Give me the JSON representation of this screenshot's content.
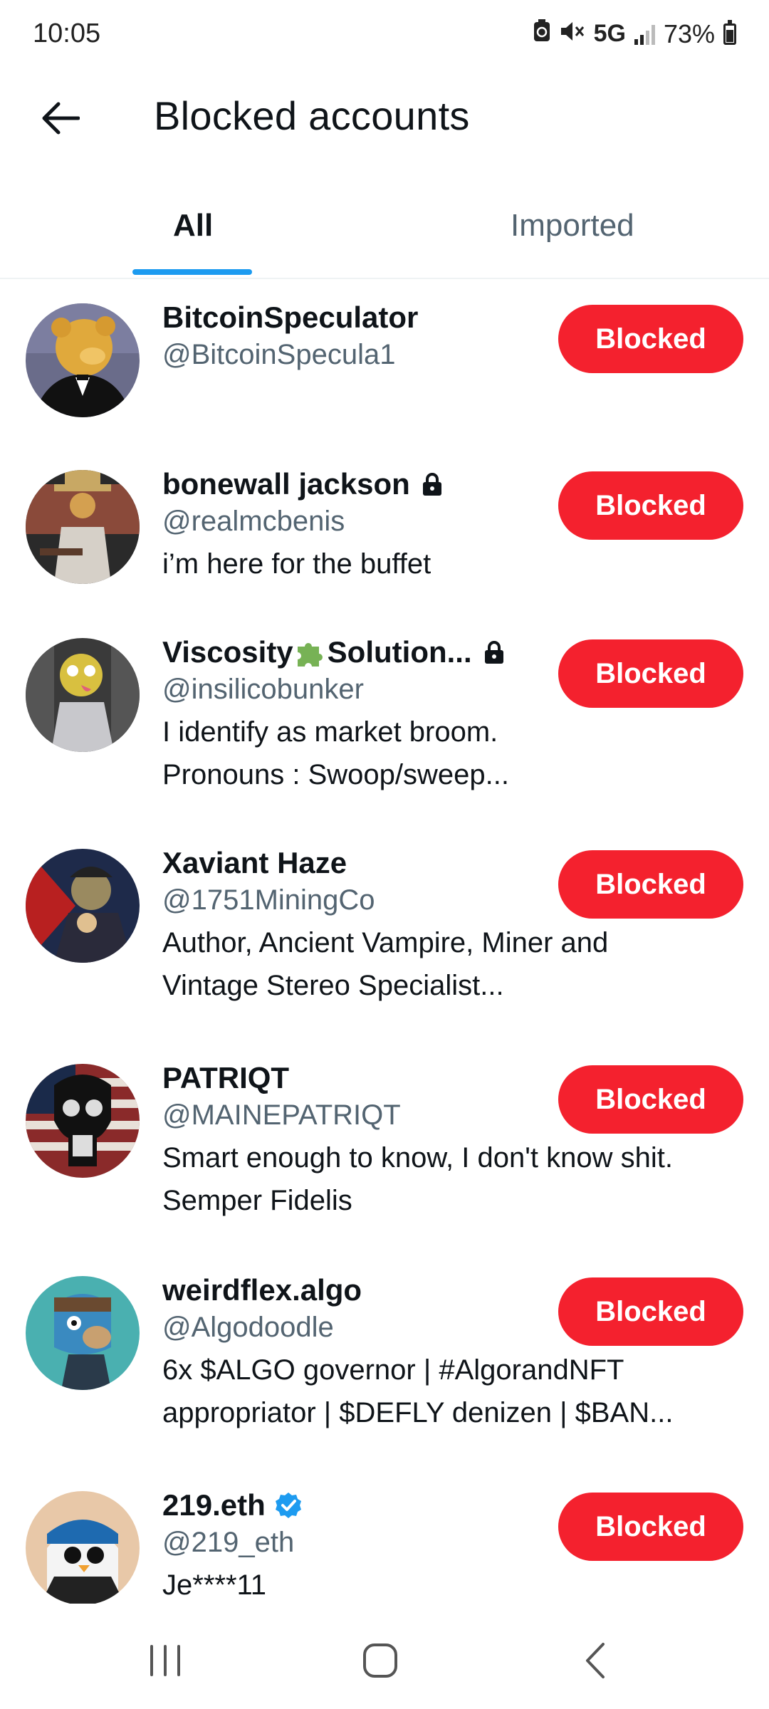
{
  "status_bar": {
    "time": "10:05",
    "network": "5G",
    "battery": "73%"
  },
  "header": {
    "title": "Blocked accounts"
  },
  "tabs": [
    {
      "label": "All"
    },
    {
      "label": "Imported"
    }
  ],
  "accounts": [
    {
      "name": "BitcoinSpeculator",
      "handle": "@BitcoinSpecula1",
      "bio": [],
      "locked": false,
      "verified": false,
      "button": "Blocked"
    },
    {
      "name": "bonewall jackson",
      "handle": "@realmcbenis",
      "bio": [
        "i’m here for the buffet"
      ],
      "locked": true,
      "verified": false,
      "button": "Blocked"
    },
    {
      "name_parts": [
        "Viscosity",
        "Solution..."
      ],
      "handle": "@insilicobunker",
      "bio": [
        "I identify as market broom.",
        "Pronouns : Swoop/sweep..."
      ],
      "locked": true,
      "verified": false,
      "button": "Blocked"
    },
    {
      "name": "Xaviant Haze",
      "handle": "@1751MiningCo",
      "bio": [
        "Author, Ancient Vampire, Miner and",
        "Vintage Stereo Specialist..."
      ],
      "locked": false,
      "verified": false,
      "button": "Blocked"
    },
    {
      "name": "PATRIQT",
      "handle": "@MAINEPATRIQT",
      "bio": [
        "Smart enough to know, I don't know shit.",
        "Semper Fidelis"
      ],
      "locked": false,
      "verified": false,
      "button": "Blocked"
    },
    {
      "name": "weirdflex.algo",
      "handle": "@Algodoodle",
      "bio": [
        "6x $ALGO governor | #AlgorandNFT",
        "appropriator | $DEFLY denizen | $BAN..."
      ],
      "locked": false,
      "verified": false,
      "button": "Blocked"
    },
    {
      "name": "219.eth",
      "handle": "@219_eth",
      "bio": [
        "Je****11"
      ],
      "locked": false,
      "verified": true,
      "button": "Blocked"
    }
  ],
  "colors": {
    "accent": "#1d9bf0",
    "blocked": "#f4212e",
    "secondary_text": "#536471"
  }
}
